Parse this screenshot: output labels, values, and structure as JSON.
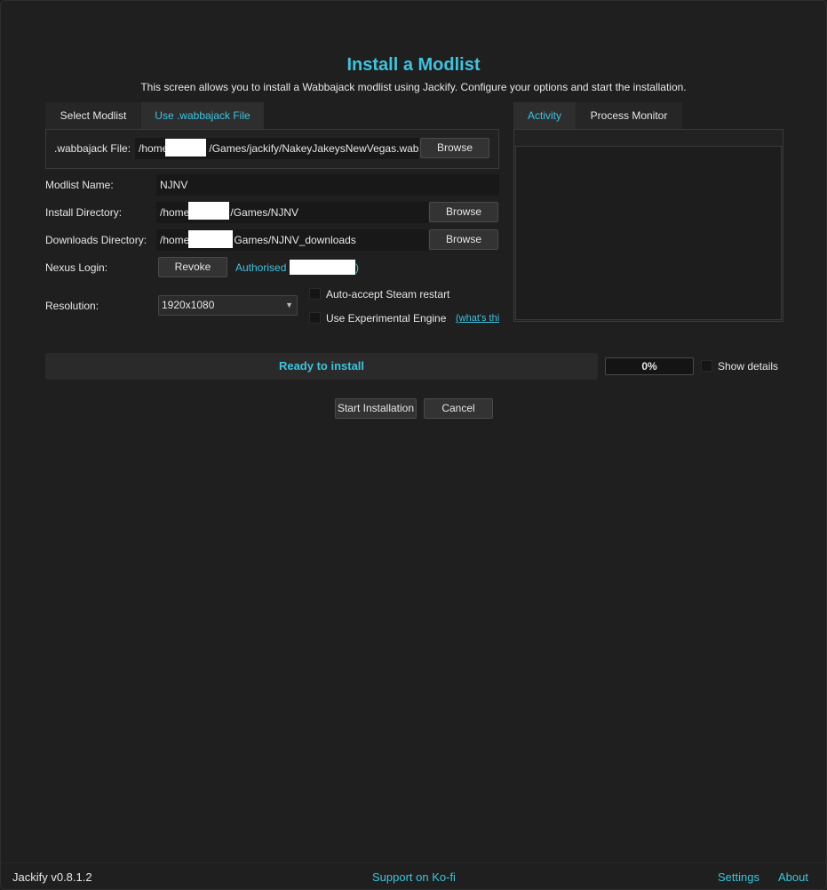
{
  "header": {
    "title": "Install a Modlist",
    "subtitle": "This screen allows you to install a Wabbajack modlist using Jackify. Configure your options and start the installation."
  },
  "source_tabs": [
    "Select Modlist",
    "Use .wabbajack File"
  ],
  "wabbajack_file": {
    "label": ".wabbajack File:",
    "prefix": "/home",
    "value": "/Games/jackify/NakeyJakeysNewVegas.wabbajack",
    "browse": "Browse"
  },
  "form": {
    "modlist_name_label": "Modlist Name:",
    "modlist_name_value": "NJNV",
    "install_dir_label": "Install Directory:",
    "install_dir_prefix": "/home",
    "install_dir_value": "/Games/NJNV",
    "downloads_dir_label": "Downloads Directory:",
    "downloads_dir_prefix": "/home",
    "downloads_dir_value": "Games/NJNV_downloads",
    "browse": "Browse",
    "nexus_label": "Nexus Login:",
    "revoke": "Revoke",
    "authorised": "Authorised",
    "authorised_suffix": ")",
    "resolution_label": "Resolution:",
    "resolution_value": "1920x1080",
    "auto_accept": "Auto-accept Steam restart",
    "experimental": "Use Experimental Engine",
    "whats_this": "(what's thi"
  },
  "side_tabs": [
    "Activity",
    "Process Monitor"
  ],
  "status": {
    "text": "Ready to install",
    "progress": "0%",
    "show_details": "Show details"
  },
  "actions": {
    "start": "Start Installation",
    "cancel": "Cancel"
  },
  "footer": {
    "version": "Jackify v0.8.1.2",
    "support": "Support on Ko-fi",
    "settings": "Settings",
    "about": "About"
  },
  "colors": {
    "accent": "#3fc3df",
    "background": "#1f1f1f"
  }
}
